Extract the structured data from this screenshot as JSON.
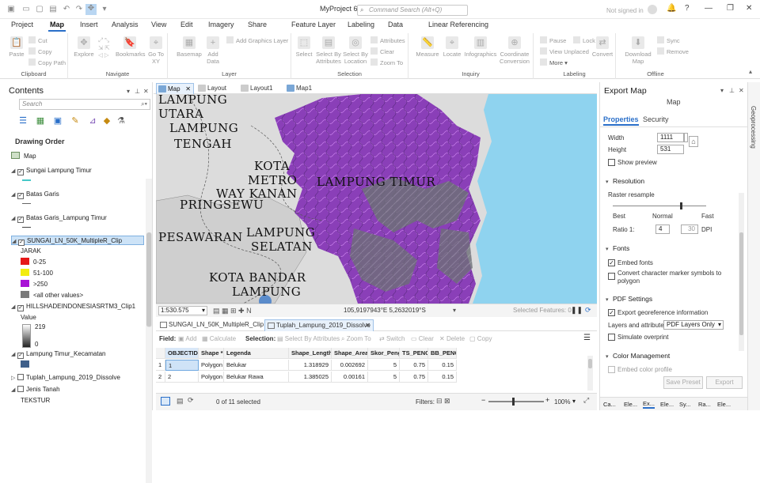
{
  "titlebar": {
    "project": "MyProject 6",
    "command_search_placeholder": "Command Search (Alt+Q)",
    "signin": "Not signed in"
  },
  "ribbon_tabs": [
    "Project",
    "Map",
    "Insert",
    "Analysis",
    "View",
    "Edit",
    "Imagery",
    "Share",
    "Feature Layer",
    "Labeling",
    "Data",
    "Linear Referencing"
  ],
  "ribbon": {
    "clipboard": {
      "label": "Clipboard",
      "paste": "Paste",
      "cut": "Cut",
      "copy": "Copy",
      "copy_path": "Copy Path"
    },
    "navigate": {
      "label": "Navigate",
      "explore": "Explore",
      "bookmarks": "Bookmarks",
      "goto": "Go To XY"
    },
    "layer": {
      "label": "Layer",
      "basemap": "Basemap",
      "add_data": "Add Data",
      "add_graphics": "Add Graphics Layer"
    },
    "selection": {
      "label": "Selection",
      "select": "Select",
      "by_attr": "Select By Attributes",
      "by_loc": "Select By Location",
      "attributes": "Attributes",
      "clear": "Clear",
      "zoom_to": "Zoom To"
    },
    "inquiry": {
      "label": "Inquiry",
      "measure": "Measure",
      "locate": "Locate",
      "infographics": "Infographics",
      "coord": "Coordinate Conversion"
    },
    "labeling": {
      "label": "Labeling",
      "pause": "Pause",
      "lock": "Lock",
      "view_unplaced": "View Unplaced",
      "more": "More"
    },
    "convert": "Convert",
    "offline": {
      "label": "Offline",
      "download": "Download Map",
      "sync": "Sync",
      "remove": "Remove"
    }
  },
  "contents": {
    "title": "Contents",
    "search_placeholder": "Search",
    "drawing_order": "Drawing Order",
    "map_label": "Map",
    "layers": [
      {
        "name": "Sungai Lampung Timur",
        "checked": true
      },
      {
        "name": "Batas Garis",
        "checked": true
      },
      {
        "name": "Batas Garis_Lampung Timur",
        "checked": true
      },
      {
        "name": "SUNGAI_LN_50K_MultipleR_Clip",
        "checked": true,
        "selected": true
      },
      {
        "name": "HILLSHADEINDONESIASRTM3_Clip1",
        "checked": true
      },
      {
        "name": "Lampung Timur_Kecamatan",
        "checked": true
      },
      {
        "name": "Tuplah_Lampung_2019_Dissolve",
        "checked": false
      },
      {
        "name": "Jenis Tanah",
        "checked": false
      }
    ],
    "jarak_field": "JARAK",
    "jarak_classes": [
      {
        "label": "0-25",
        "color": "#e61717"
      },
      {
        "label": "51-100",
        "color": "#f2ec10"
      },
      {
        "label": ">250",
        "color": "#a812d6"
      },
      {
        "label": "<all other values>",
        "color": "#7a7a7a"
      }
    ],
    "value_label": "Value",
    "value_high": "219",
    "value_low": "0",
    "tekstur": "TEKSTUR"
  },
  "map_tabs": [
    "Map",
    "Layout",
    "Layout1",
    "Map1"
  ],
  "map_labels": [
    "LAMPUNG",
    "UTARA",
    "LAMPUNG",
    "TENGAH",
    "KOTA",
    "METRO",
    "WAY KANAN",
    "PRINGSEWU",
    "LAMPUNG TIMUR",
    "PESAWARAN",
    "LAMPUNG",
    "SELATAN",
    "KOTA BANDAR",
    "LAMPUNG"
  ],
  "status": {
    "scale": "1:530.575",
    "coords": "105,9197943°E 5,2632019°S",
    "selected_features": "Selected Features: 0"
  },
  "attr_tabs": [
    "SUNGAI_LN_50K_MultipleR_Clip",
    "Tuplah_Lampung_2019_Dissolve"
  ],
  "attr_toolbar": {
    "field": "Field:",
    "add": "Add",
    "calculate": "Calculate",
    "selection": "Selection:",
    "by_attr": "Select By Attributes",
    "zoom_to": "Zoom To",
    "switch": "Switch",
    "clear": "Clear",
    "delete": "Delete",
    "copy": "Copy"
  },
  "attr_table": {
    "columns": [
      "OBJECTID *",
      "Shape *",
      "Legenda",
      "Shape_Length",
      "Shape_Area",
      "Skor_Peng",
      "TS_PENG",
      "BB_PENG"
    ],
    "rows": [
      {
        "idx": "1",
        "cells": [
          "1",
          "Polygon",
          "Belukar",
          "1.318929",
          "0.002692",
          "5",
          "0.75",
          "0.15"
        ]
      },
      {
        "idx": "2",
        "cells": [
          "2",
          "Polygon",
          "Belukar Rawa",
          "1.385025",
          "0.00161",
          "5",
          "0.75",
          "0.15"
        ]
      }
    ],
    "footer_selected": "0 of 11 selected",
    "filters": "Filters:",
    "zoom": "100%"
  },
  "export": {
    "title": "Export Map",
    "subtitle": "Map",
    "tabs": [
      "Properties",
      "Security"
    ],
    "width_label": "Width",
    "width_value": "1111",
    "height_label": "Height",
    "height_value": "531",
    "show_preview": "Show preview",
    "resolution": "Resolution",
    "raster_resample": "Raster resample",
    "best": "Best",
    "normal": "Normal",
    "fast": "Fast",
    "resample_level": 0.72,
    "ratio_label": "Ratio 1:",
    "ratio_value": "4",
    "dpi_value": "30",
    "dpi_label": "DPI",
    "fonts": "Fonts",
    "embed_fonts": "Embed fonts",
    "convert_marker": "Convert character marker symbols to polygon",
    "pdf_settings": "PDF Settings",
    "export_georef": "Export georeference information",
    "layers_attrs": "Layers and attributes",
    "pdf_layers_only": "PDF Layers Only",
    "simulate_overprint": "Simulate overprint",
    "color_management": "Color Management",
    "embed_color_profile": "Embed color profile",
    "save_preset": "Save Preset",
    "export_btn": "Export",
    "bottom_tabs": [
      "Ca...",
      "Ele...",
      "Ex...",
      "Ele...",
      "Sy...",
      "Ra...",
      "Ele..."
    ]
  },
  "geoprocessing": "Geoprocessing"
}
